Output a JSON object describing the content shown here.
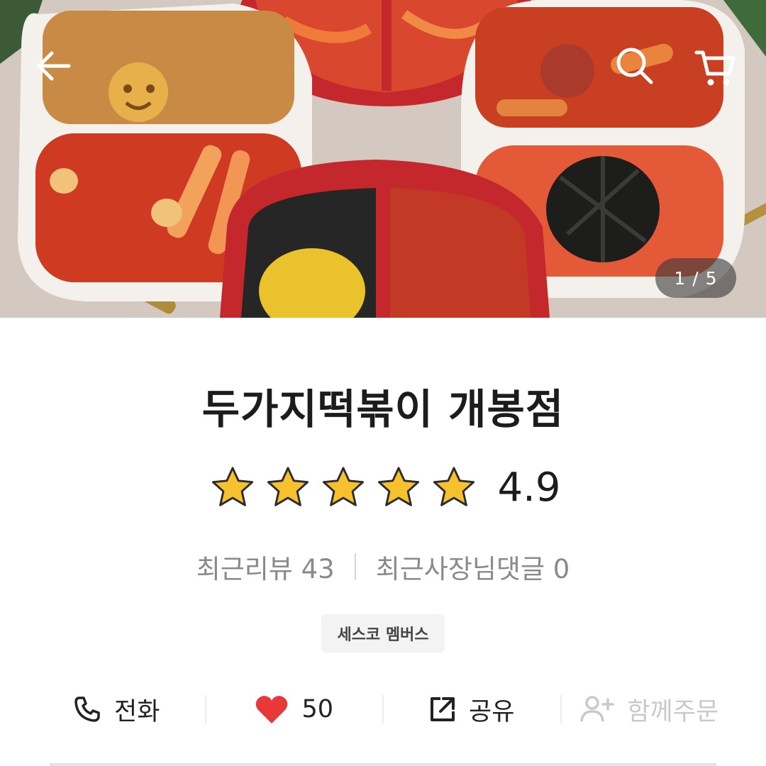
{
  "gallery": {
    "counter": "1 / 5",
    "current": 1,
    "total": 5
  },
  "header": {
    "back_icon": "arrow-left-icon",
    "search_icon": "search-icon",
    "cart_icon": "cart-icon",
    "icon_color": "#ffffff"
  },
  "store": {
    "name": "두가지떡볶이 개봉점",
    "rating": "4.9",
    "stars": 5,
    "star_color": "#f7c12e",
    "recent_reviews": "최근리뷰 43",
    "owner_replies": "최근사장님댓글 0",
    "badge": "세스코 멤버스"
  },
  "actions": {
    "call": {
      "label": "전화",
      "icon": "phone-icon"
    },
    "like": {
      "label": "50",
      "icon": "heart-icon",
      "color": "#e8383a"
    },
    "share": {
      "label": "공유",
      "icon": "share-icon"
    },
    "group_order": {
      "label": "함께주문",
      "icon": "add-user-icon",
      "disabled": true
    }
  }
}
